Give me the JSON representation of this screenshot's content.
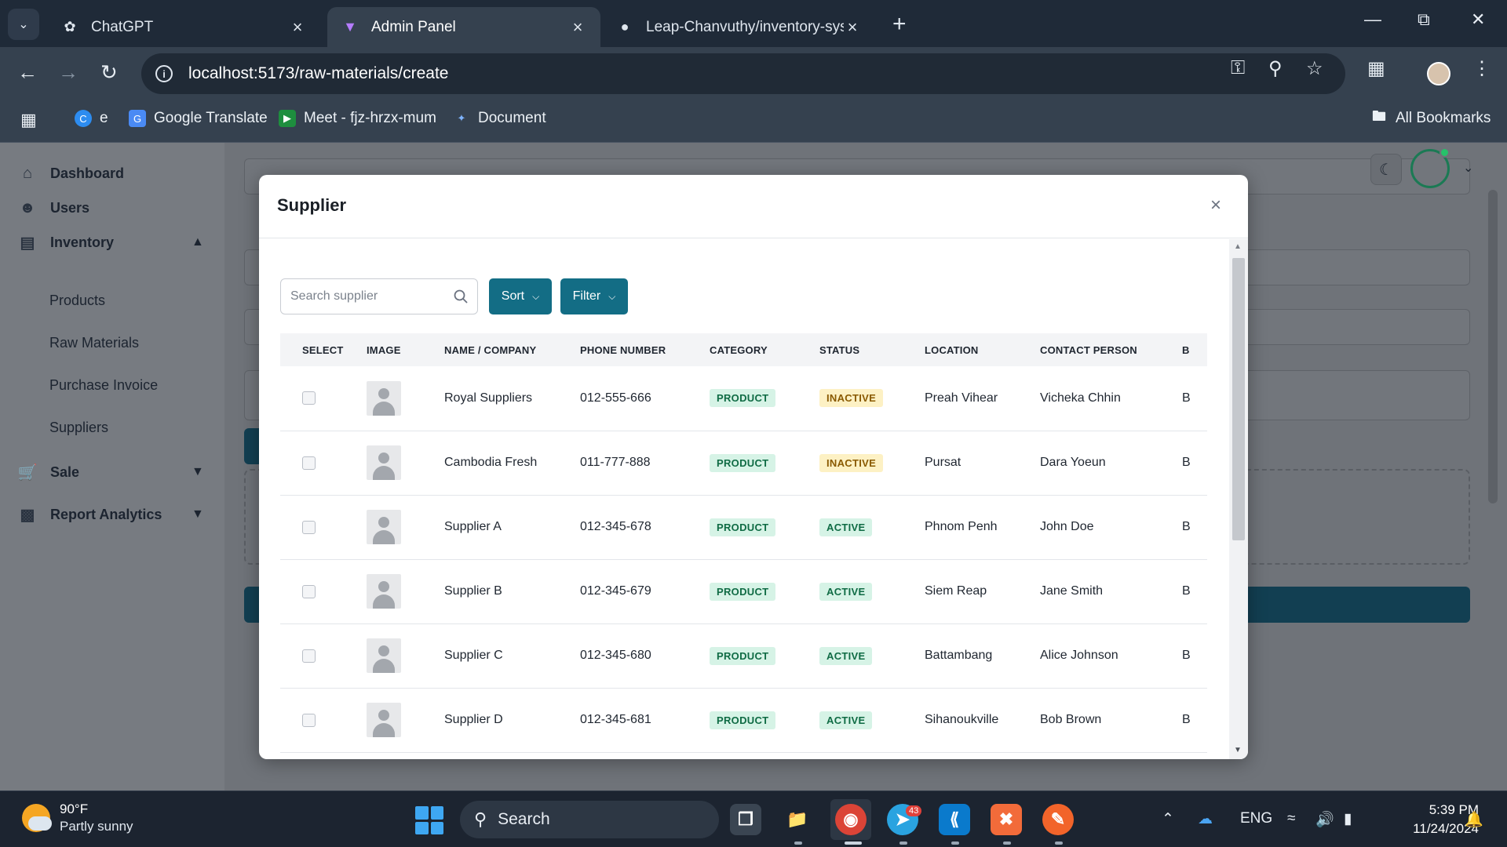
{
  "browser": {
    "tabs": [
      {
        "title": "ChatGPT",
        "icon": "chatgpt-icon"
      },
      {
        "title": "Admin Panel",
        "icon": "vite-icon",
        "active": true
      },
      {
        "title": "Leap-Chanvuthy/inventory-syst",
        "icon": "github-icon"
      }
    ],
    "url": "localhost:5173/raw-materials/create",
    "bookmarks": [
      {
        "label": "e",
        "icon": "canva-icon"
      },
      {
        "label": "Google Translate",
        "icon": "google-translate-icon"
      },
      {
        "label": "Meet - fjz-hrzx-mum",
        "icon": "meet-icon"
      },
      {
        "label": "Document",
        "icon": "document-icon"
      }
    ],
    "all_bookmarks": "All Bookmarks"
  },
  "sidebar": {
    "dashboard": "Dashboard",
    "users": "Users",
    "inventory": "Inventory",
    "inventory_items": [
      "Products",
      "Raw Materials",
      "Purchase Invoice",
      "Suppliers"
    ],
    "sale": "Sale",
    "report": "Report Analytics"
  },
  "modal": {
    "title": "Supplier",
    "search_placeholder": "Search supplier",
    "sort_label": "Sort",
    "filter_label": "Filter",
    "columns": [
      "SELECT",
      "IMAGE",
      "NAME / COMPANY",
      "PHONE NUMBER",
      "CATEGORY",
      "STATUS",
      "LOCATION",
      "CONTACT PERSON",
      "B"
    ],
    "rows": [
      {
        "name": "Royal Suppliers",
        "phone": "012-555-666",
        "category": "PRODUCT",
        "status": "INACTIVE",
        "location": "Preah Vihear",
        "contact": "Vicheka Chhin",
        "extra": "B"
      },
      {
        "name": "Cambodia Fresh",
        "phone": "011-777-888",
        "category": "PRODUCT",
        "status": "INACTIVE",
        "location": "Pursat",
        "contact": "Dara Yoeun",
        "extra": "B"
      },
      {
        "name": "Supplier A",
        "phone": "012-345-678",
        "category": "PRODUCT",
        "status": "ACTIVE",
        "location": "Phnom Penh",
        "contact": "John Doe",
        "extra": "B"
      },
      {
        "name": "Supplier B",
        "phone": "012-345-679",
        "category": "PRODUCT",
        "status": "ACTIVE",
        "location": "Siem Reap",
        "contact": "Jane Smith",
        "extra": "B"
      },
      {
        "name": "Supplier C",
        "phone": "012-345-680",
        "category": "PRODUCT",
        "status": "ACTIVE",
        "location": "Battambang",
        "contact": "Alice Johnson",
        "extra": "B"
      },
      {
        "name": "Supplier D",
        "phone": "012-345-681",
        "category": "PRODUCT",
        "status": "ACTIVE",
        "location": "Sihanoukville",
        "contact": "Bob Brown",
        "extra": "B"
      }
    ]
  },
  "taskbar": {
    "weather_temp": "90°F",
    "weather_desc": "Partly sunny",
    "search": "Search",
    "language": "ENG",
    "time": "5:39 PM",
    "date": "11/24/2024",
    "telegram_badge": "43"
  },
  "colors": {
    "primary_button": "#136d85",
    "active_badge": "#d6f3e6",
    "inactive_badge": "#fdf1c4"
  }
}
